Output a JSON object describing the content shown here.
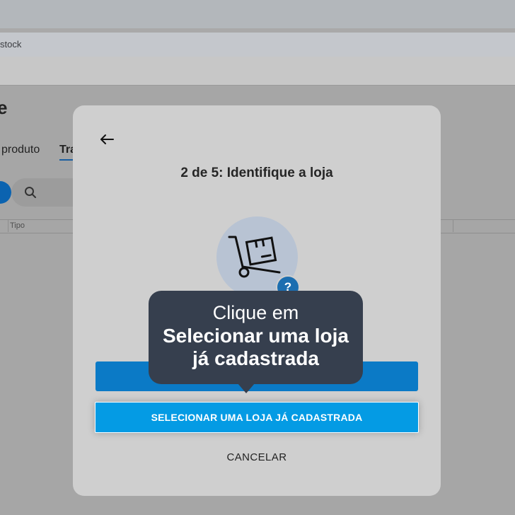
{
  "browser": {
    "address_text": "stock"
  },
  "background": {
    "title": "e",
    "tabs": [
      "produto",
      "Tra"
    ],
    "table_header": "Tipo"
  },
  "modal": {
    "title": "2 de 5: Identifique a loja",
    "back_icon": "arrow-left-icon",
    "illustration_icon": "hand-truck-box-icon",
    "help_badge": "?",
    "select_button_label": "SELECIONAR UMA LOJA JÁ CADASTRADA",
    "cancel_label": "CANCELAR"
  },
  "tooltip": {
    "line1": "Clique em",
    "line2": "Selecionar uma loja",
    "line3": "já cadastrada"
  },
  "colors": {
    "accent": "#049be4",
    "primary": "#0b7ac6",
    "tooltip_bg": "#363f4e"
  }
}
